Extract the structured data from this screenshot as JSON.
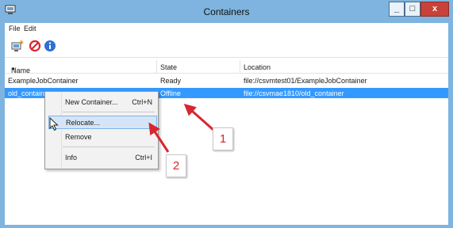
{
  "window": {
    "title": "Containers",
    "minimize_label": "_",
    "maximize_label": "□",
    "close_label": "x"
  },
  "menu": {
    "file": "File",
    "edit": "Edit"
  },
  "toolbar": {
    "icons": [
      "new-container-icon",
      "stop-icon",
      "info-icon"
    ]
  },
  "columns": {
    "name": "Name",
    "name_sort": "▲",
    "state": "State",
    "location": "Location"
  },
  "rows": [
    {
      "name": "ExampleJobContainer",
      "state": "Ready",
      "location": "file://csvmtest01/ExampleJobContainer"
    },
    {
      "name": "old_contain",
      "state": "Offline",
      "location": "file://csvmae1810/old_container"
    }
  ],
  "context_menu": {
    "new_container": "New Container...",
    "new_container_shortcut": "Ctrl+N",
    "relocate": "Relocate...",
    "remove": "Remove",
    "info": "Info",
    "info_shortcut": "Ctrl+I"
  },
  "callouts": {
    "one": "1",
    "two": "2"
  },
  "colors": {
    "selection": "#3399ff",
    "title_bar": "#7eb4df",
    "callout_red": "#d8262f",
    "menu_hover": "#d5e5f7"
  }
}
